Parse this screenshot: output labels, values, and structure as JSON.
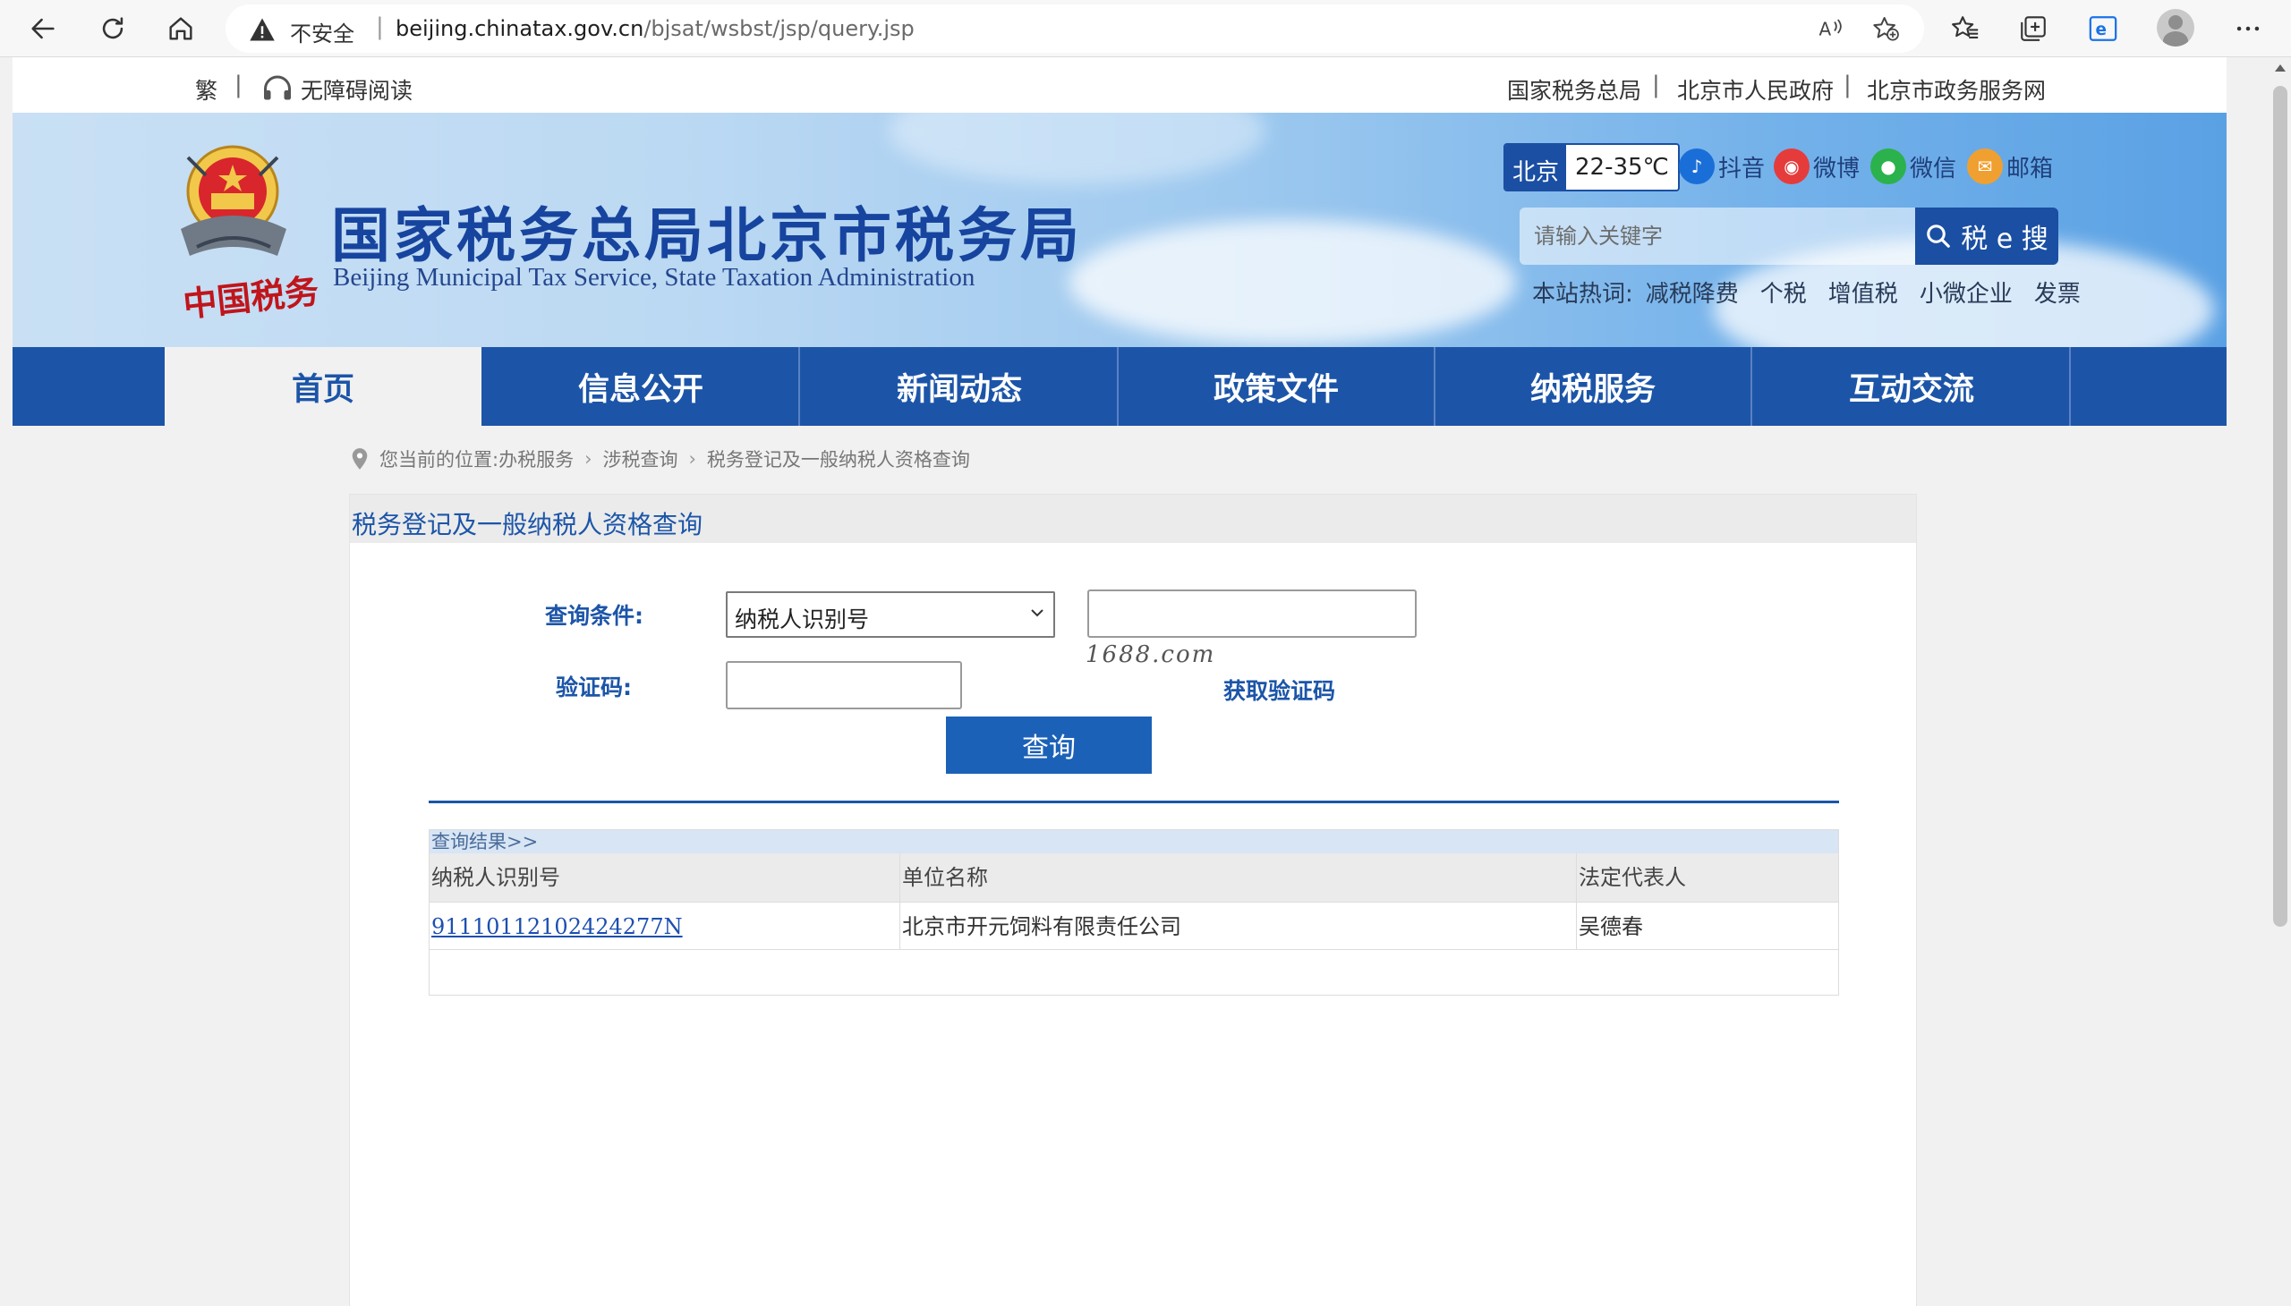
{
  "browser": {
    "security_label": "不安全",
    "url_host": "beijing.chinatax.gov.cn",
    "url_path": "/bjsat/wsbst/jsp/query.jsp",
    "nav_icons": [
      "back-icon",
      "refresh-icon",
      "home-icon"
    ],
    "toolbar_icons": [
      "read-aloud-icon",
      "add-favorite-icon",
      "favorites-icon",
      "collections-icon",
      "edge-icon",
      "profile-avatar",
      "more-icon"
    ]
  },
  "utility": {
    "traditional": "繁",
    "sep": "|",
    "accessibility": "无障碍阅读",
    "links": [
      "国家税务总局",
      "北京市人民政府",
      "北京市政务服务网"
    ]
  },
  "header": {
    "emblem_text": "中国税务",
    "title": "国家税务总局北京市税务局",
    "subtitle": "Beijing Municipal Tax Service, State Taxation Administration",
    "weather_city": "北京",
    "weather_temp": "22-35℃",
    "social": [
      {
        "label": "抖音",
        "icon": "douyin-icon",
        "color": "#1a6ed8"
      },
      {
        "label": "微博",
        "icon": "weibo-icon",
        "color": "#e63b3b"
      },
      {
        "label": "微信",
        "icon": "wechat-icon",
        "color": "#2bb24c"
      },
      {
        "label": "邮箱",
        "icon": "mail-icon",
        "color": "#f0a030"
      }
    ],
    "search_placeholder": "请输入关键字",
    "search_button": "税 e 搜",
    "hot_label": "本站热词:",
    "hot_words": [
      "减税降费",
      "个税",
      "增值税",
      "小微企业",
      "发票"
    ]
  },
  "nav": {
    "items": [
      "首页",
      "信息公开",
      "新闻动态",
      "政策文件",
      "纳税服务",
      "互动交流"
    ],
    "active": "首页"
  },
  "breadcrumb": {
    "prefix": "您当前的位置:",
    "items": [
      "办税服务",
      "涉税查询",
      "税务登记及一般纳税人资格查询"
    ]
  },
  "panel": {
    "title": "税务登记及一般纳税人资格查询",
    "query_label": "查询条件:",
    "query_type": "纳税人识别号",
    "query_value": "",
    "captcha_label": "验证码:",
    "captcha_value": "",
    "captcha_image_text": "1688.com",
    "get_code": "获取验证码",
    "submit": "查询"
  },
  "results": {
    "caption": "查询结果>>",
    "columns": [
      "纳税人识别号",
      "单位名称",
      "法定代表人"
    ],
    "rows": [
      [
        "91110112102424277N",
        "北京市开元饲料有限责任公司",
        "吴德春"
      ]
    ]
  },
  "colors": {
    "brand_blue": "#1c55a8",
    "nav_blue": "#1c55a8",
    "link_blue": "#1c4fb0",
    "accent_red": "#c0151b"
  }
}
